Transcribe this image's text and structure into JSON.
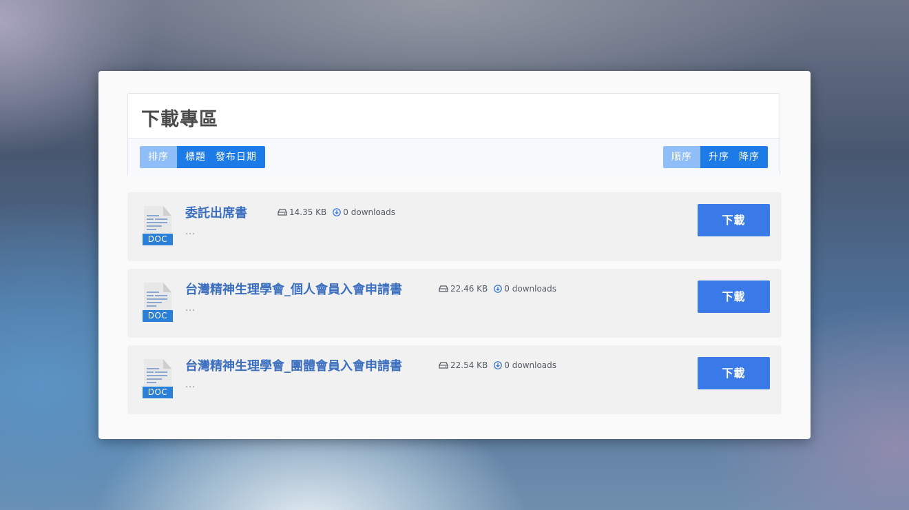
{
  "header": {
    "title": "下載專區"
  },
  "sort": {
    "label": "排序",
    "options": [
      "標題",
      "發布日期"
    ]
  },
  "order": {
    "label": "順序",
    "options": [
      "升序",
      "降序"
    ]
  },
  "files": [
    {
      "title": "委託出席書",
      "size": "14.35 KB",
      "downloads": "0 downloads",
      "description": "...",
      "type": "DOC",
      "button": "下載"
    },
    {
      "title": "台灣精神生理學會_個人會員入會申請書",
      "size": "22.46 KB",
      "downloads": "0 downloads",
      "description": "...",
      "type": "DOC",
      "button": "下載"
    },
    {
      "title": "台灣精神生理學會_團體會員入會申請書",
      "size": "22.54 KB",
      "downloads": "0 downloads",
      "description": "...",
      "type": "DOC",
      "button": "下載"
    }
  ],
  "icons": {
    "file": "doc-file-icon",
    "size": "hard-drive-icon",
    "downloads": "download-circle-icon"
  },
  "colors": {
    "accent": "#1c7be6",
    "accent_light": "#8fbdf7",
    "button": "#3a7ae8",
    "title": "#3c6fbf"
  }
}
